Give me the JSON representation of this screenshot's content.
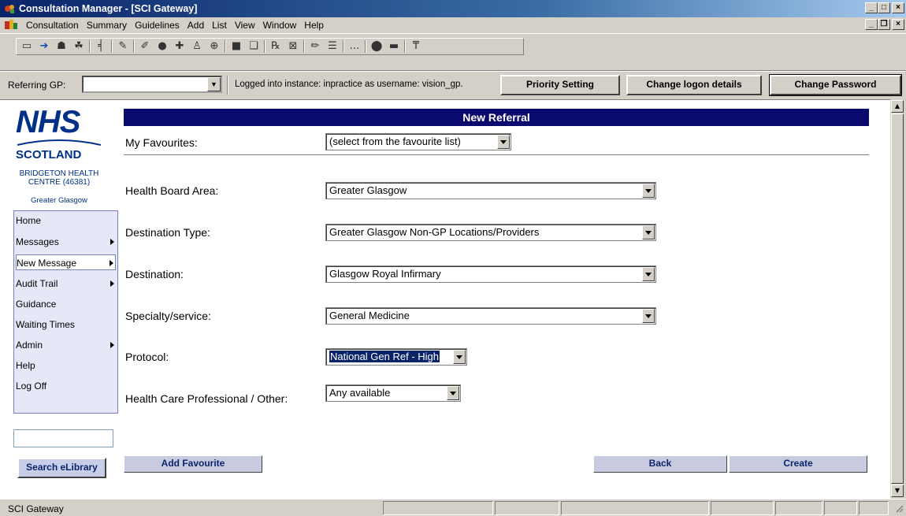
{
  "window": {
    "title": "Consultation Manager - [SCI Gateway]"
  },
  "menu": {
    "items": [
      "Consultation",
      "Summary",
      "Guidelines",
      "Add",
      "List",
      "View",
      "Window",
      "Help"
    ]
  },
  "referrer": {
    "label": "Referring GP:",
    "value": "",
    "logged_in_text": "Logged into instance: inpractice as username: vision_gp.",
    "buttons": {
      "priority": "Priority Setting",
      "change_logon": "Change logon details",
      "change_password": "Change Password"
    }
  },
  "sidebar": {
    "logo_nhs": "NHS",
    "logo_scotland": "SCOTLAND",
    "practice_name_line1": "BRIDGETON HEALTH",
    "practice_name_line2": "CENTRE (46381)",
    "practice_area": "Greater Glasgow",
    "nav": [
      {
        "label": "Home",
        "submenu": false
      },
      {
        "label": "Messages",
        "submenu": true
      },
      {
        "label": "New Message",
        "submenu": true,
        "active": true
      },
      {
        "label": "Audit Trail",
        "submenu": true
      },
      {
        "label": "Guidance",
        "submenu": false
      },
      {
        "label": "Waiting Times",
        "submenu": false
      },
      {
        "label": "Admin",
        "submenu": true
      },
      {
        "label": "Help",
        "submenu": false
      },
      {
        "label": "Log Off",
        "submenu": false
      }
    ],
    "search_value": "",
    "search_button": "Search eLibrary"
  },
  "form": {
    "title": "New Referral",
    "favourites": {
      "label": "My Favourites:",
      "value": "(select from the favourite list)"
    },
    "health_board": {
      "label": "Health Board Area:",
      "value": "Greater Glasgow"
    },
    "destination_type": {
      "label": "Destination Type:",
      "value": "Greater Glasgow Non-GP Locations/Providers"
    },
    "destination": {
      "label": "Destination:",
      "value": "Glasgow Royal Infirmary"
    },
    "specialty": {
      "label": "Specialty/service:",
      "value": "General Medicine"
    },
    "protocol": {
      "label": "Protocol:",
      "value": "National Gen Ref - High"
    },
    "hcp": {
      "label": "Health Care Professional / Other:",
      "value": "Any available"
    },
    "buttons": {
      "add_favourite": "Add Favourite",
      "back": "Back",
      "create": "Create"
    }
  },
  "status": {
    "text": "SCI Gateway"
  }
}
